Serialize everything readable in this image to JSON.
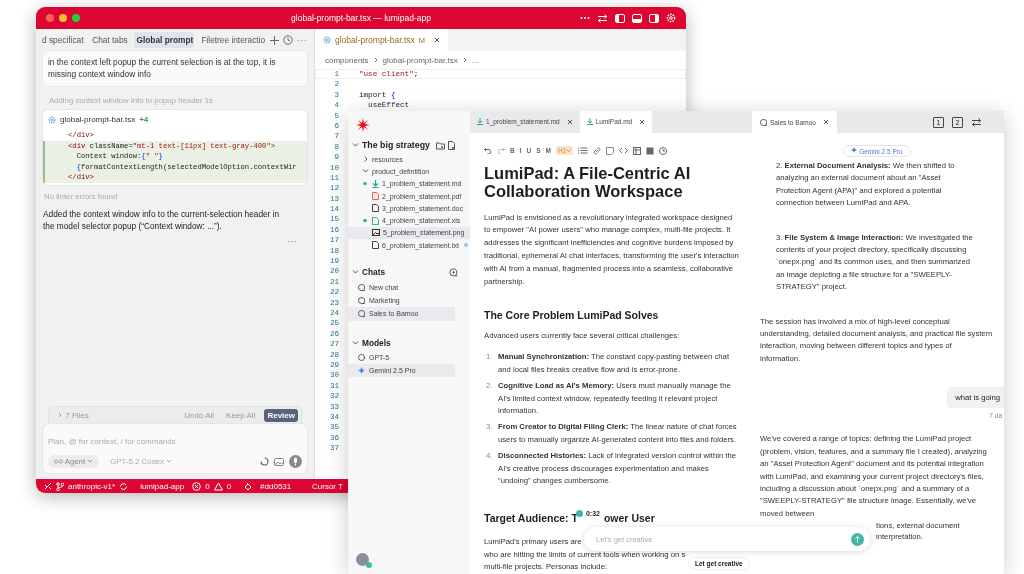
{
  "editor_window": {
    "title": "global-prompt-bar.tsx — lumipad-app",
    "chat_tabs": [
      {
        "label": "d specificat",
        "selected": false
      },
      {
        "label": "Chat tabs",
        "selected": false
      },
      {
        "label": "Global prompt",
        "selected": true
      },
      {
        "label": "Filetree interactio",
        "selected": false
      }
    ],
    "user_message": "in the context left popup the current selection is at the top, it is missing context window info",
    "activity": "Adding context window info to popup header",
    "activity_time": "1s",
    "diff_card": {
      "file": "global-prompt-bar.tsx",
      "added": "+4",
      "lines": [
        {
          "text": "</div>",
          "added": false
        },
        {
          "text": "<div className=\"mt-1 text-[11px] text-gray-400\">",
          "added": true
        },
        {
          "text": "  Context window:{\" \"}",
          "added": true
        },
        {
          "text": "  {formatContextLength(selectedModelOption.contextWir",
          "added": true
        },
        {
          "text": "</div>",
          "added": true
        }
      ]
    },
    "lint_status": "No linter errors found",
    "reply": "Added the context window info to the current-selection header in the model selector popup (“Context window: ...”).",
    "files_bar": {
      "label": "7 Files",
      "buttons": [
        {
          "label": "Undo All",
          "primary": false
        },
        {
          "label": "Keep All",
          "primary": false
        },
        {
          "label": "Review",
          "primary": true
        }
      ]
    },
    "composer": {
      "placeholder": "Plan, @ for context, / for commands",
      "mode": "Agent",
      "model": "GPT-5.2 Codex"
    },
    "file_tab": {
      "label": "global-prompt-bar.tsx",
      "status": "M"
    },
    "breadcrumb": [
      "components",
      "global-prompt-bar.tsx",
      "..."
    ],
    "code_lines": [
      {
        "number": "1",
        "text": "\"use client\";"
      },
      {
        "number": "2"
      },
      {
        "number": "3",
        "text": "import {"
      },
      {
        "number": "4",
        "text": "  useEffect"
      },
      {
        "number": "5"
      },
      {
        "number": "6"
      },
      {
        "number": "7"
      },
      {
        "number": "8"
      },
      {
        "number": "9"
      },
      {
        "number": "10"
      },
      {
        "number": "11"
      },
      {
        "number": "12"
      },
      {
        "number": "13"
      },
      {
        "number": "14"
      },
      {
        "number": "15"
      },
      {
        "number": "16"
      },
      {
        "number": "17"
      },
      {
        "number": "18"
      },
      {
        "number": "19"
      },
      {
        "number": "20"
      },
      {
        "number": "21"
      },
      {
        "number": "22"
      },
      {
        "number": "23"
      },
      {
        "number": "24"
      },
      {
        "number": "25"
      },
      {
        "number": "26"
      },
      {
        "number": "27"
      },
      {
        "number": "28"
      },
      {
        "number": "29"
      },
      {
        "number": "30"
      },
      {
        "number": "31"
      },
      {
        "number": "32"
      },
      {
        "number": "33"
      },
      {
        "number": "34"
      },
      {
        "number": "35"
      },
      {
        "number": "36"
      },
      {
        "number": "37"
      }
    ],
    "status_bar": {
      "branch": "anthropic-v1*",
      "project": "lumipad-app",
      "errors": "0",
      "warnings": "0",
      "color_label": "#dd0531",
      "right": "Cursor T"
    }
  },
  "lumipad_window": {
    "sidebar": {
      "workspace": "The big strategy",
      "tree": [
        {
          "name": "resources",
          "expanded": false,
          "selected": false
        },
        {
          "name": "product_defintition",
          "expanded": true,
          "selected": false,
          "children": [
            {
              "name": "1_problem_statement.md",
              "kind": "md",
              "selected": false,
              "color": "#34c26b"
            },
            {
              "name": "2_problem_statement.pdf",
              "kind": "pdf",
              "selected": false
            },
            {
              "name": "3_problem_statement.doc",
              "kind": "doc",
              "selected": false
            },
            {
              "name": "4_problem_statement.xls",
              "kind": "xls",
              "selected": false,
              "color": "#34c26b"
            },
            {
              "name": "5_problem_statement.png",
              "kind": "png",
              "selected": true
            },
            {
              "name": "6_problem_statement.txt",
              "kind": "txt",
              "selected": false,
              "badge": {
                "color": "#9cc8f0"
              }
            }
          ]
        }
      ],
      "chats_header": "Chats",
      "chats": [
        {
          "name": "New chat",
          "selected": false
        },
        {
          "name": "Marketing",
          "selected": false
        },
        {
          "name": "Sales to Bamoo",
          "selected": true
        }
      ],
      "models_header": "Models",
      "models": [
        {
          "name": "GPT-5",
          "kind": "gpt",
          "selected": false
        },
        {
          "name": "Gemini 2.5 Pro",
          "kind": "gemini",
          "selected": true
        }
      ]
    },
    "tabs": [
      {
        "label": "1_problem_statement.md",
        "selected": false
      },
      {
        "label": "LumiPad.md",
        "selected": true
      }
    ],
    "chat_tab": "Sales to Bamoo",
    "panel_buttons": [
      "1",
      "2"
    ],
    "toolbar": {
      "marks": [
        "B",
        "I",
        "U",
        "S",
        "M"
      ],
      "heading": {
        "label": "H1",
        "active": true
      }
    },
    "document": {
      "title": "LumiPad: A File-Centric AI Collaboration Workspace",
      "intro": "LumiPad is envisioned as a revolutionary integrated workspace designed to empower \"AI power users\" who manage complex, multi-file projects. It addresses the significant inefficiencies and cognitive burdens imposed by traditional, ephemeral AI chat interfaces, transforming the user's interaction with AI from a manual, fragmented process into a seamless, collaborative partnership.",
      "section_1": "The Core Problem LumiPad Solves",
      "lead": "Advanced users currently face several critical challenges:",
      "challenges": [
        {
          "number": "1.",
          "text": "**Manual Synchronization:** The constant copy-pasting between chat and local files breaks creative flow and is error-prone."
        },
        {
          "number": "2.",
          "text": "**Cognitive Load as AI's Memory:** Users must manually manage the AI's limited context window, repeatedly feeding it relevant project information."
        },
        {
          "number": "3.",
          "text": "**From Creator to Digital Filing Clerk:** The linear nature of chat forces users to manually organize AI-generated content into files and folders."
        },
        {
          "number": "4.",
          "text": "**Disconnected Histories:** Lack of integrated version control within the AI's creative process discourages experimentation and makes \"undoing\" changes cumbersome."
        }
      ],
      "section_2": {
        "before": "Target Audience: T",
        "after": "ower User"
      },
      "recording_time": "0:32",
      "audience_lines": [
        "LumiPad's primary users are",
        "who are hitting the limits of current tools when working on s",
        "multi-file projects. Personas include:"
      ]
    },
    "chat": {
      "model_chip": "Gemini 2.5 Pro",
      "messages": [
        {
          "kind": "assistant",
          "indent": true,
          "text": "2. **External Document Analysis:** We then shifted to analyzing an external document about an \"Asset Protection Agent (APA)\" and explored a potential connection between LumiPad and APA."
        },
        {
          "kind": "assistant",
          "indent": true,
          "text": "3. **File System & Image Interaction:** We investigated the contents of your project directory, specifically discussing `onepx.png` and its common uses, and then summarized an image depicting a file structure for a \"SWEEPLY-STRATEGY\" project."
        },
        {
          "kind": "assistant",
          "indent": false,
          "text": "The session has involved a mix of high-level conceptual understanding, detailed document analysis, and practical file system interaction, moving between different topics and types of information."
        },
        {
          "kind": "user",
          "text": "what is going",
          "time": "7 da"
        },
        {
          "kind": "assistant",
          "indent": false,
          "text": "We've covered a range of topics: defining the LumiPad project (problem, vision, features, and a summary file I created), analyzing an \"Asset Protection Agent\" document and its potential integration with LumiPad, and examining your current project directory's files, including a discussion about `onepx.png` and a summary of a \"SWEEPLY-STRATEGY\" file structure image. Essentially, we've moved between",
          "tail_lines": [
            "tions, external document",
            "interpretation."
          ]
        }
      ]
    },
    "composer_placeholder": "Let's get creative",
    "suggestion": "Let get creative"
  }
}
